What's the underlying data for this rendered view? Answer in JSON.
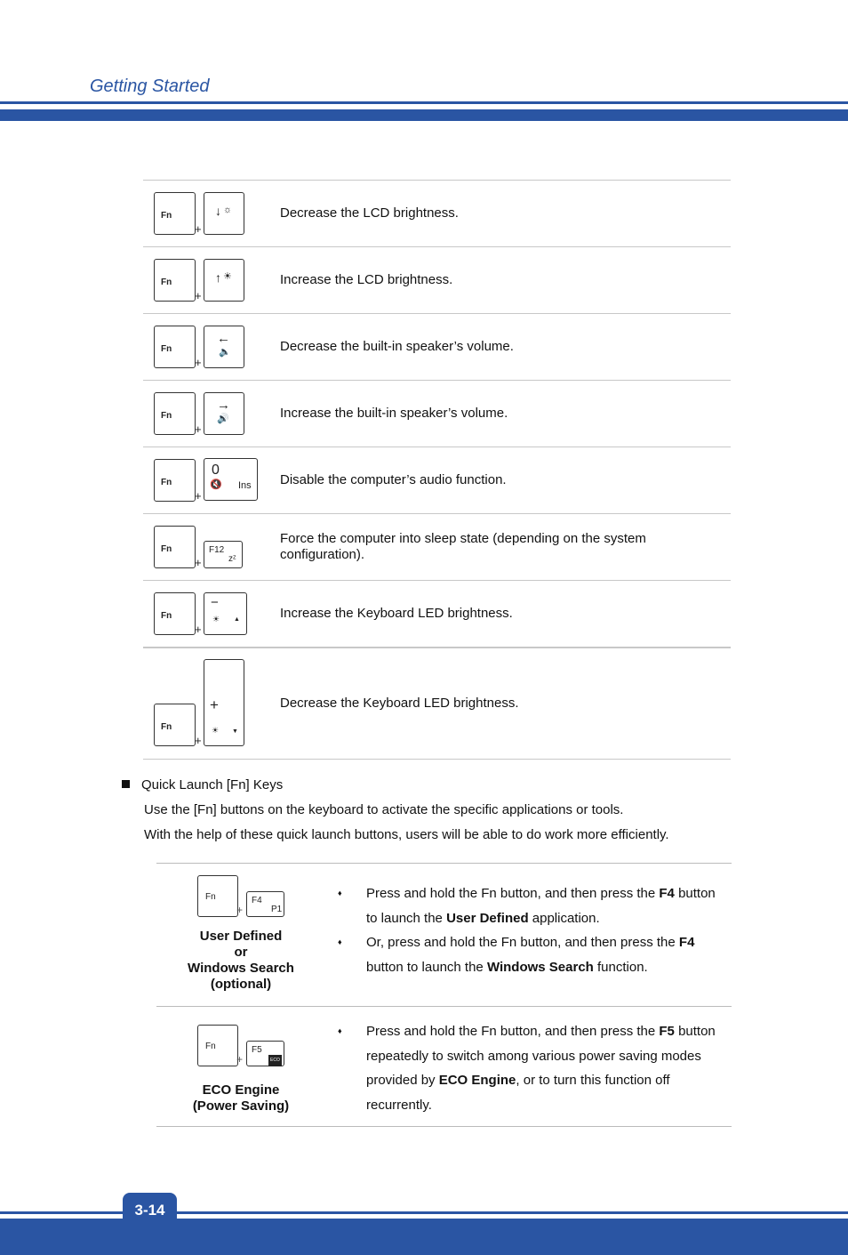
{
  "header": {
    "title": "Getting Started"
  },
  "fn_combos": [
    {
      "fn_key": "Fn",
      "combo_key": "brightness-down",
      "description": "Decrease the LCD brightness."
    },
    {
      "fn_key": "Fn",
      "combo_key": "brightness-up",
      "description": "Increase the LCD brightness."
    },
    {
      "fn_key": "Fn",
      "combo_key": "volume-down",
      "description": "Decrease the built-in speaker’s volume."
    },
    {
      "fn_key": "Fn",
      "combo_key": "volume-up",
      "description": "Increase the built-in speaker’s volume."
    },
    {
      "fn_key": "Fn",
      "combo_key": "mute",
      "key_top": "0",
      "key_sub": "Ins",
      "description": "Disable the computer’s audio function."
    },
    {
      "fn_key": "Fn",
      "combo_key": "sleep",
      "key_top": "F12",
      "key_sub": "zᶻ",
      "description": "Force the computer into sleep state (depending on the system configuration)."
    },
    {
      "fn_key": "Fn",
      "combo_key": "kbd-led-up",
      "key_top": "−",
      "description": "Increase the Keyboard LED brightness."
    },
    {
      "fn_key": "Fn",
      "combo_key": "kbd-led-down",
      "key_top": "+",
      "description": "Decrease the Keyboard LED brightness."
    }
  ],
  "plus_sign": "+",
  "quick_launch": {
    "heading": "Quick Launch [Fn] Keys",
    "para1": "Use the [Fn] buttons on the keyboard to activate the specific applications or tools.",
    "para2": "With the help of these quick launch buttons, users will be able to do work more efficiently.",
    "items": [
      {
        "fn_key": "Fn",
        "key_top": "F4",
        "key_sub": "P1",
        "caption": [
          "User Defined",
          "or",
          "Windows Search",
          "(optional)"
        ],
        "bullets": [
          [
            "Press and hold the Fn button, and then press the ",
            "F4",
            " button to launch the ",
            "User Defined",
            " application."
          ],
          [
            "Or, press and hold the Fn button, and then press the ",
            "F4",
            " button to launch the ",
            "Windows Search",
            " function."
          ]
        ]
      },
      {
        "fn_key": "Fn",
        "key_top": "F5",
        "key_sub": "ECO",
        "caption": [
          "ECO Engine",
          "(Power Saving)"
        ],
        "bullets": [
          [
            "Press and hold the Fn button, and then press the ",
            "F5",
            " button repeatedly to switch among various power saving modes provided by ",
            "ECO Engine",
            ", or to turn this function off recurrently."
          ]
        ]
      }
    ]
  },
  "footer": {
    "page_number": "3-14"
  },
  "colors": {
    "accent": "#2a55a3"
  }
}
